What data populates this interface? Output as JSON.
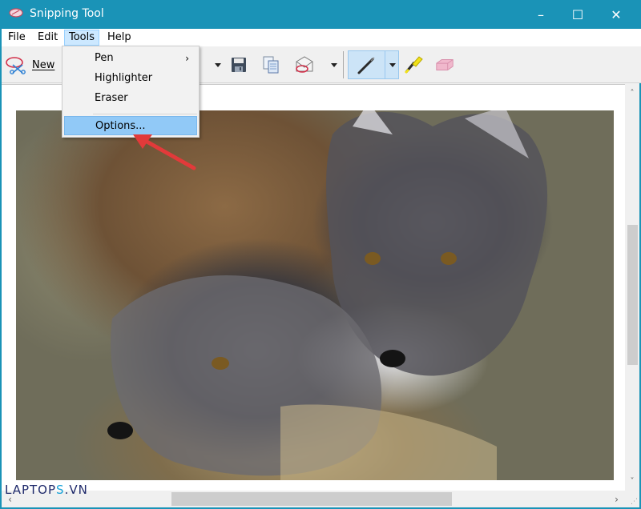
{
  "window": {
    "title": "Snipping Tool",
    "app_icon": "snipping-tool-icon",
    "controls": {
      "minimize": "–",
      "maximize": "☐",
      "close": "✕"
    },
    "accent_color": "#1a93b7"
  },
  "menubar": {
    "items": [
      {
        "label": "File"
      },
      {
        "label": "Edit"
      },
      {
        "label": "Tools",
        "active": true
      },
      {
        "label": "Help"
      }
    ]
  },
  "toolbar": {
    "new_label": "New",
    "new_icon": "scissors-new-snip-icon",
    "buttons": [
      {
        "icon": "mode-dropdown-arrow"
      },
      {
        "icon": "save-icon"
      },
      {
        "icon": "copy-icon"
      },
      {
        "icon": "send-email-icon"
      },
      {
        "icon": "send-dropdown-arrow"
      },
      {
        "icon": "pen-icon",
        "selected": true
      },
      {
        "icon": "pen-dropdown-arrow"
      },
      {
        "icon": "highlighter-icon"
      },
      {
        "icon": "eraser-icon"
      }
    ]
  },
  "tools_menu": {
    "items": [
      {
        "label": "Pen",
        "submenu_arrow": "›"
      },
      {
        "label": "Highlighter"
      },
      {
        "label": "Eraser"
      },
      {
        "label": "Options...",
        "highlighted": true
      }
    ]
  },
  "canvas": {
    "image_alt": "Photo of two arctic fox kits cuddling"
  },
  "scrollbars": {
    "up": "˄",
    "down": "˅",
    "left": "‹",
    "right": "›",
    "grip": "⋰"
  },
  "watermark": {
    "text_main": "LAPTOP",
    "text_accent": "S",
    "text_tail": ".VN"
  }
}
